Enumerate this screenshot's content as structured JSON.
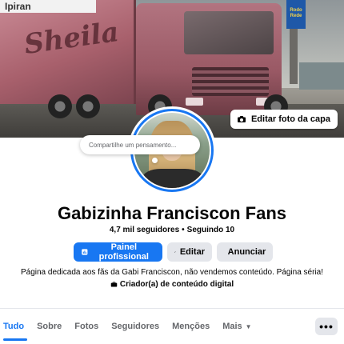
{
  "cover": {
    "trailer_brand": "Ipiran",
    "trailer_logo": "Sheila",
    "sign_text": "Rodo Rede",
    "edit_label": "Editar foto da capa",
    "edit_icon": "camera-icon"
  },
  "composer": {
    "placeholder": "Compartilhe um pensamento..."
  },
  "profile": {
    "name": "Gabizinha Franciscon Fans",
    "followers": "4,7 mil seguidores",
    "following": "Seguindo 10",
    "separator": "•"
  },
  "actions": {
    "dashboard_label": "Painel profissional",
    "edit_label": "Editar",
    "ads_label": "Anunciar"
  },
  "about": {
    "bio": "Página dedicada aos fãs da Gabi Franciscon, não vendemos conteúdo. Página séria!",
    "category": "Criador(a) de conteúdo digital"
  },
  "tabs": [
    {
      "label": "Tudo"
    },
    {
      "label": "Sobre"
    },
    {
      "label": "Fotos"
    },
    {
      "label": "Seguidores"
    },
    {
      "label": "Menções"
    },
    {
      "label": "Mais"
    }
  ],
  "more_button": "•••",
  "colors": {
    "accent": "#1877f2",
    "secondary_button": "#e4e6eb",
    "text": "#050505",
    "muted_text": "#65676b"
  }
}
